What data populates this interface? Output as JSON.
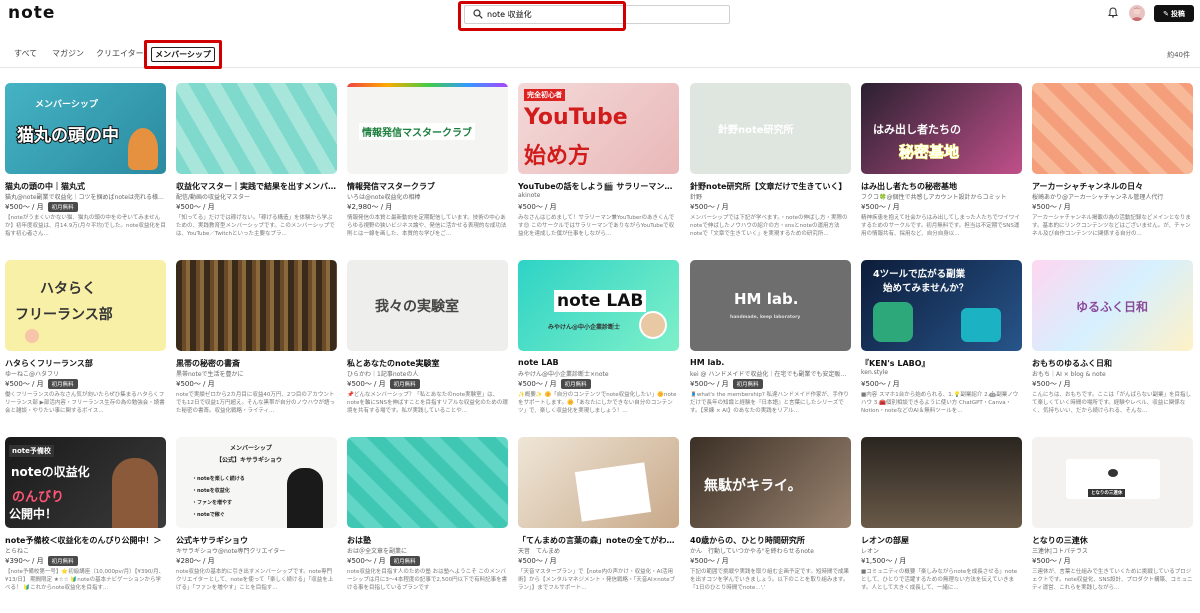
{
  "header": {
    "logo": "note",
    "search_value": "note 収益化",
    "post_label": "投稿"
  },
  "tabs": [
    "すべて",
    "マガジン",
    "クリエイター",
    "メンバーシップ"
  ],
  "result_count": "約40件",
  "badge_label": "初月無料",
  "cards": [
    {
      "title": "猫丸の頭の中｜猫丸式",
      "author": "猫丸@note副業で収益化｜コツを掴めばnoteは売れる様...",
      "price": "¥500～ / 月",
      "badge": true,
      "desc": "【noteがうまくいかない猫、猫丸の頭の中をのぞいてみませんか】初年度収益は、月14.9万(月々平均)でした。note収益化を目指す初心者さん...",
      "thumb_text": [
        "メンバーシップ",
        "猫丸の頭の中"
      ]
    },
    {
      "title": "収益化マスター｜実践で結果を出すメンバーシップ",
      "author": "配信/動画の収益化マスター",
      "price": "¥500～ / 月",
      "badge": false,
      "desc": "「知ってる」だけでは稼げない。「稼げる構造」を体験から学ぶための、実践教育型メンバーシップです。このメンバーシップでは、YouTube／Twitchといった主要なプラ...",
      "thumb_text": []
    },
    {
      "title": "情報発信マスタークラブ",
      "author": "いろは@note収益化の相棒",
      "price": "¥2,980～ / 月",
      "badge": false,
      "desc": "情報発信の本質と最新動向を定期配信しています。技術の中心あらゆる視野の狭いビジネス論や、発信に活かせる表現的な成功法則とは一線を画した、本質的な学びをご...",
      "thumb_text": [
        "情報発信マスタークラブ"
      ]
    },
    {
      "title": "YouTubeの話をしよう🎬 サラリーマンのYouTube挑戦...",
      "author": "akinote",
      "price": "¥500～ / 月",
      "badge": false,
      "desc": "みなさんはじめまして！サラリーマン兼YouTuberのあきくんです😊 このサークルではサラリーマンでありながらYouTubeで収益化を達成した僕が仕事をしながら...",
      "thumb_text": [
        "完全初心者",
        "YouTube",
        "始め方"
      ]
    },
    {
      "title": "針野note研究所【文章だけで生きていく】",
      "author": "針野",
      "price": "¥500～ / 月",
      "badge": false,
      "desc": "メンバーシップでは下記が学べます。・noteの伸ばし方・実際のnoteで伸ばしたノウハウの紹介の方・snsとnoteの運用方法 noteで「文章で生きていく」を実現するための研究所...",
      "thumb_text": [
        "針野note研究所"
      ]
    },
    {
      "title": "はみ出し者たちの秘密基地",
      "author": "フクコ🍀@個性で共感しアカウント設計からコミット",
      "price": "¥500～ / 月",
      "badge": false,
      "desc": "精神疾患を抱えて社会からはみ出してしまった人たちでワイワイするためのサークルです。初月無料です。担当は不定期でSNS運用の情報共有、採用など、自分自身以...",
      "thumb_text": [
        "はみ出し者たちの",
        "秘密基地"
      ]
    },
    {
      "title": "アーカーシャチャンネルの日々",
      "author": "桜崎あかり@アーカーシャチャンネル管理人代行",
      "price": "¥500～ / 月",
      "badge": false,
      "desc": "アーカーシャチャンネル掲載の為の活動記録などメインとなります。基本的にリンクコンテンツなどはございません。が、チャンネル及び自作コンテンツに関係する自分の...",
      "thumb_text": []
    },
    {
      "title": "ハタらくフリーランス部",
      "author": "ゆーねこ@ハタフリ",
      "price": "¥500～ / 月",
      "badge": true,
      "desc": "働くフリーランスのみなさん気が向いたらぜひ集まるハタらくフリーランス部 ▶部活内容・フリーランス生存の為の勉強会・読書会と雑談・やりたい事に関するボイス...",
      "thumb_text": [
        "ハタらく",
        "フリーランス部"
      ]
    },
    {
      "title": "黒帯の秘密の書斎",
      "author": "黒帯noteで生活を豊かに",
      "price": "¥500～ / 月",
      "badge": false,
      "desc": "noteで実績ゼロから2カ月目に収益40万円、2つ目のアカウントでも12日で収益1万円超え。そんな黒帯が自分のノウハウが語った秘密の書斎。収益化戦略・ライティ...",
      "thumb_text": []
    },
    {
      "title": "私とあなたのnote実験室",
      "author": "ひらかわ｜1記事noteの人",
      "price": "¥500～ / 月",
      "badge": true,
      "desc": "📌どんなメンバーシップ？「私とあなたのnote実験室」は、noteを軸にSNSを伸ばすことを目指すリアルな収益化のための環境を共有する場です。私が実践していることや...",
      "thumb_text": [
        "我々の実験室"
      ]
    },
    {
      "title": "note LAB",
      "author": "みやけん@中小企業診断士×note",
      "price": "¥500～ / 月",
      "badge": true,
      "desc": "✨概要✨ 🌼「自分のコンテンツでnote収益化したい」🌼noteをサポートします。🌼「あなたにしかできない自分のコンテンツ」で、楽しく収益化を実現しましょう！...",
      "thumb_text": [
        "note LAB",
        "みやけん@中小企業診断士"
      ]
    },
    {
      "title": "HM lab.",
      "author": "kei @ ハンドメイドで収益化｜在宅でも副業でも安定販売...",
      "price": "¥500～ / 月",
      "badge": true,
      "desc": "🧵what's the membership? 私達ハンドメイド作家が、手作りだけで長年の知識と経験を『日本語』と言葉にしたシリーズです。【来練 × AI】のあなたの実践をリアル...",
      "thumb_text": [
        "HM lab.",
        "handmade, keep laboratory"
      ]
    },
    {
      "title": "『KEN's LABO』",
      "author": "ken.style",
      "price": "¥500～ / 月",
      "badge": false,
      "desc": "■内容 スマホ1台から始められる、1.💡副業紹介 2.🤖副業ノウハウ 3.🧰個別相談できるように使い方 ChatGPT・Canva・Notion・noteなどのAI＆無料ツールを...",
      "thumb_text": [
        "4ツールで広がる副業",
        "始めてみませんか？"
      ]
    },
    {
      "title": "おもちのゆるふく日和",
      "author": "おもち｜AI × blog & note",
      "price": "¥500～ / 月",
      "badge": false,
      "desc": "こんにちは、おもちです。ここは「がんばらない副業」を目指して楽しくていく時間の場所です。経験やレベル、収益に関係なく、気持ちいい、だから続けられる、そんな...",
      "thumb_text": [
        "ゆるふく日和"
      ]
    },
    {
      "title": "note予備校＜収益化をのんびり公開中！＞",
      "author": "とらねこ",
      "price": "¥390～ / 月",
      "badge": true,
      "desc": "【note予備校第一号】⭐初級講座（10,000pv/月）【¥390/月、¥13/日】 期間限定 ★☆☆ 🔰noteの基本ナビゲーションから学べる！ 🔰これからnote収益化を目指す...",
      "thumb_text": [
        "note予備校",
        "noteの収益化",
        "のんびり",
        "公開中！"
      ]
    },
    {
      "title": "公式キサラギショウ",
      "author": "キサラギショウ@note専門クリエイター",
      "price": "¥280～ / 月",
      "badge": false,
      "desc": "note収益化の基本的に引き出すメンバーシップです。note専門クリエイターとして、noteを使って「楽しく続ける」「収益を上げる」「ファンを増やす」ことを目指す...",
      "thumb_text": [
        "メンバーシップ",
        "【公式】キサラギショウ",
        "・noteを楽しく続ける",
        "・noteを収益化",
        "・ファンを増やす",
        "・noteで稼ぐ"
      ]
    },
    {
      "title": "おは塾",
      "author": "おは＠全文章を副業に",
      "price": "¥500～ / 月",
      "badge": true,
      "desc": "note収益化を目指す人のための塾 おは塾へようこそ このメンバーシップは月に3〜4本程度の記事で2,500円以下で有料記事を書ける事を目指しているプランです",
      "thumb_text": []
    },
    {
      "title": "「てんまめの言葉の森」noteの全てがわかる！",
      "author": "天音　てんまめ",
      "price": "¥500～ / 月",
      "badge": false,
      "desc": "「天音マスタープラン」で【note内の声かけ・収益化・AI活用術】から【メンタルマネジメント・発信戦略・「天音AI×noteブラン」】までフルサポート...",
      "thumb_text": []
    },
    {
      "title": "40歳からの、ひとり時間研究所",
      "author": "かん　行動していつかやる\"を終わらせるnote",
      "price": "¥500～ / 月",
      "badge": false,
      "desc": "下記の範囲で挑戦や実践を取り組む企画予定です。短時間で成果を出すコツを学んでいきましょう。以下のことを取り組みます。『1日のひとり時間でnote...','",
      "thumb_text": [
        "無駄がキライ。"
      ]
    },
    {
      "title": "レオンの部屋",
      "author": "レオン",
      "price": "¥1,500～ / 月",
      "badge": false,
      "desc": "■コミュニティの概要「楽しみながらnoteを成長させる」noteとして、ひとりで活躍するための無理ない方法を伝えていきます。人として大きく成長して、一緒に...",
      "thumb_text": []
    },
    {
      "title": "となりの三連休",
      "author": "三連休|コトパテラス",
      "price": "¥500～ / 月",
      "badge": false,
      "desc": "三連休が、言葉と仕組みで生きていくために挑戦しているプロジェクトです。note収益化、SNS設計、プロダクト構築、コミュニティ運営、これらを実践しながら...",
      "thumb_text": [
        "となりの三連休"
      ]
    }
  ]
}
